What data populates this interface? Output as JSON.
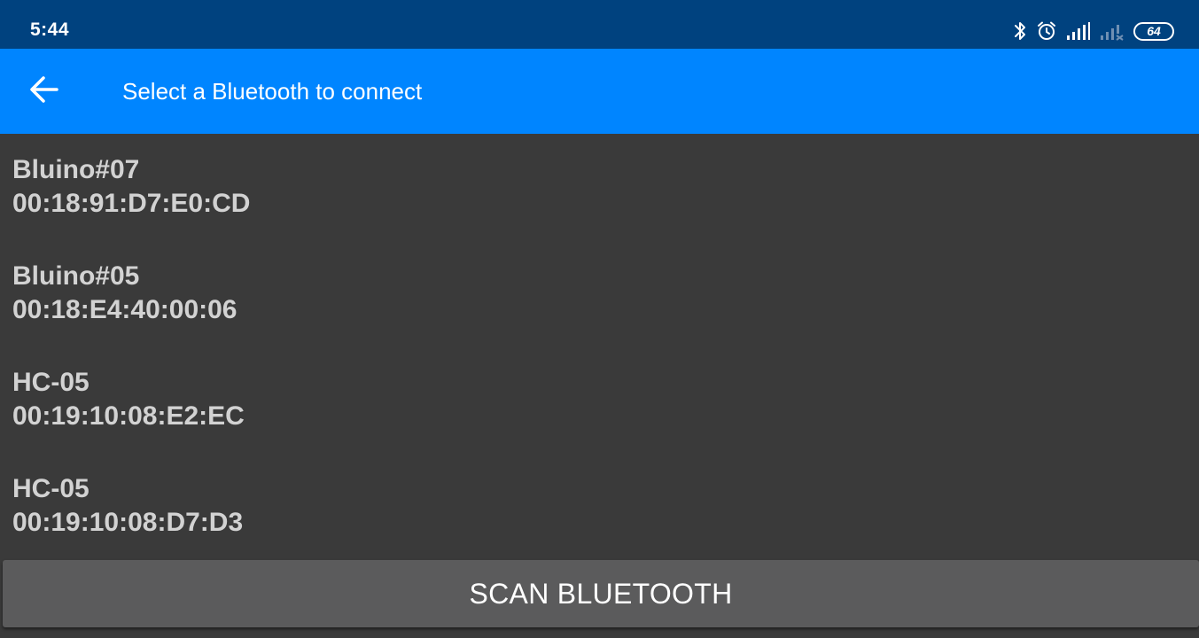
{
  "status_bar": {
    "time": "5:44",
    "icons": [
      "bluetooth-icon",
      "alarm-icon",
      "signal-icon",
      "signal-no-service-icon",
      "battery-icon"
    ],
    "battery_level": "64"
  },
  "app_bar": {
    "back_icon": "arrow-left-icon",
    "title": "Select a Bluetooth to connect",
    "background": "#0085ff"
  },
  "devices": [
    {
      "name": "Bluino#07",
      "address": "00:18:91:D7:E0:CD"
    },
    {
      "name": "Bluino#05",
      "address": "00:18:E4:40:00:06"
    },
    {
      "name": "HC-05",
      "address": "00:19:10:08:E2:EC"
    },
    {
      "name": "HC-05",
      "address": "00:19:10:08:D7:D3"
    }
  ],
  "scan_button": {
    "label": "SCAN BLUETOOTH"
  },
  "colors": {
    "status_bar": "#00427f",
    "background": "#3a3a3a",
    "text": "#d2d2d2",
    "button": "#5b5b5c"
  }
}
